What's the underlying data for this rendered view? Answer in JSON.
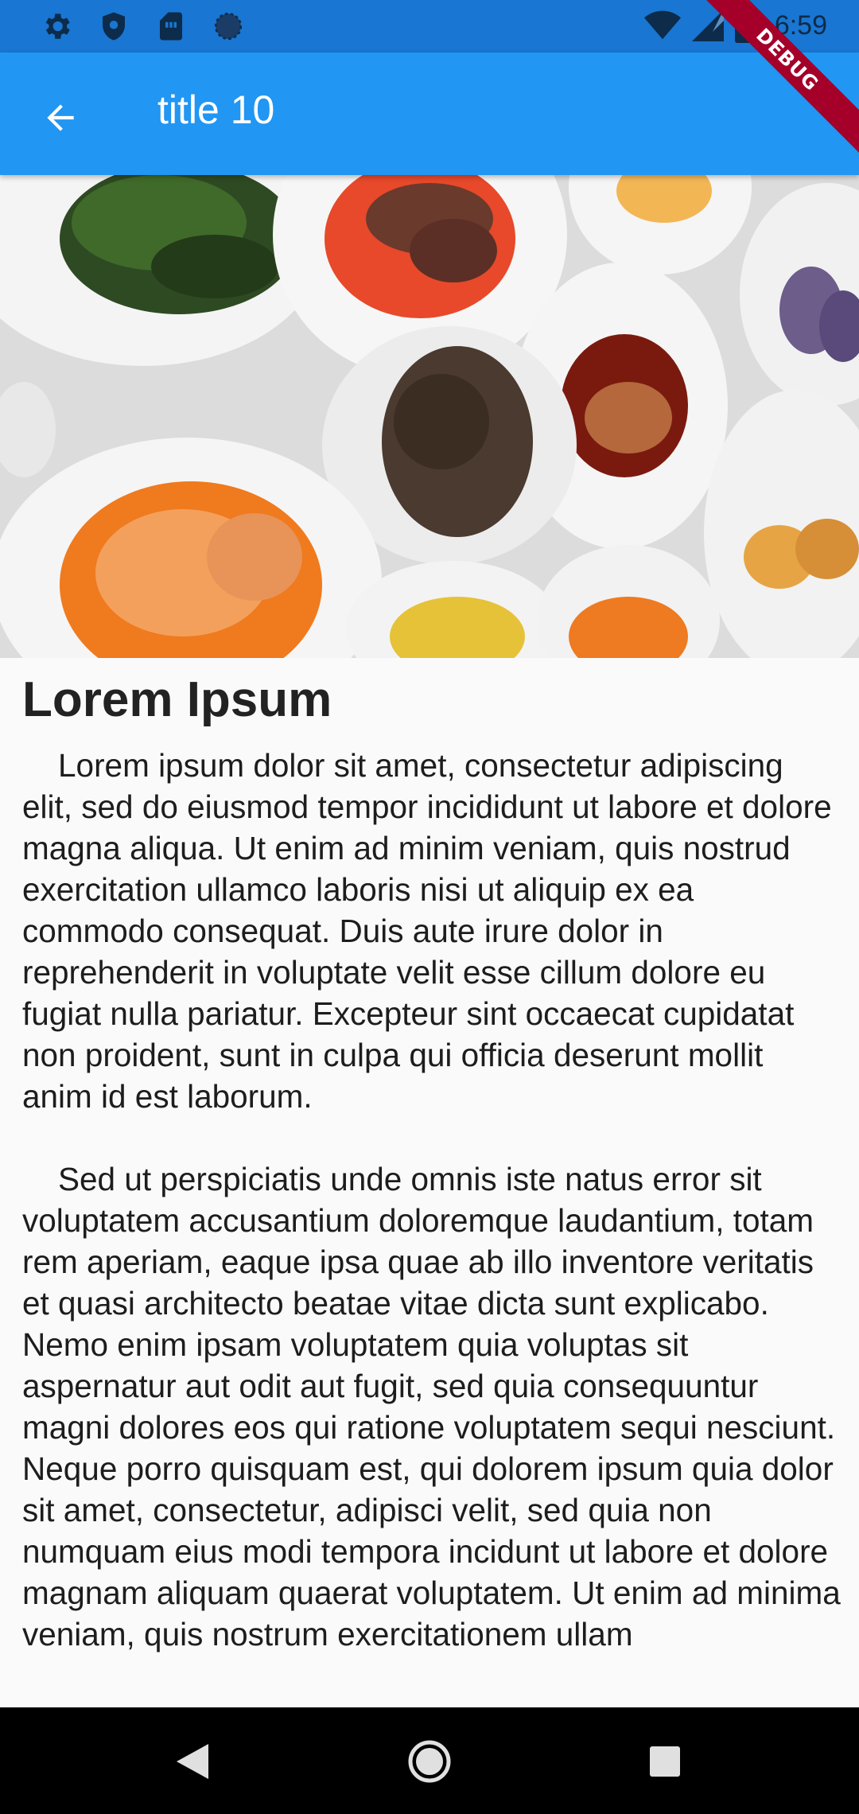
{
  "status_bar": {
    "time": "6:59",
    "icons_left": [
      "settings-icon",
      "shield-icon",
      "sim-card-icon",
      "circle-icon"
    ],
    "icons_right": [
      "wifi-icon",
      "cell-signal-icon",
      "battery-icon"
    ]
  },
  "app_bar": {
    "back_icon": "arrow-back-icon",
    "title": "title 10",
    "color": "#2196f3"
  },
  "debug_banner": "DEBUG",
  "hero_image": {
    "description_icon": "food-plates-image"
  },
  "article": {
    "title": "Lorem Ipsum",
    "paragraph_1": "    Lorem ipsum dolor sit amet, consectetur adipiscing elit, sed do eiusmod tempor incididunt ut labore et dolore magna aliqua. Ut enim ad minim veniam, quis nostrud exercitation ullamco laboris nisi ut aliquip ex ea commodo consequat. Duis aute irure dolor in reprehenderit in voluptate velit esse cillum dolore eu fugiat nulla pariatur. Excepteur sint occaecat cupidatat non proident, sunt in culpa qui officia deserunt mollit anim id est laborum.",
    "paragraph_2": "    Sed ut perspiciatis unde omnis iste natus error sit voluptatem accusantium doloremque laudantium, totam rem aperiam, eaque ipsa quae ab illo inventore veritatis et quasi architecto beatae vitae dicta sunt explicabo. Nemo enim ipsam voluptatem quia voluptas sit aspernatur aut odit aut fugit, sed quia consequuntur magni dolores eos qui ratione voluptatem sequi nesciunt. Neque porro quisquam est, qui dolorem ipsum quia dolor sit amet, consectetur, adipisci velit, sed quia non numquam eius modi tempora incidunt ut labore et dolore magnam aliquam quaerat voluptatem. Ut enim ad minima veniam, quis nostrum exercitationem ullam"
  },
  "nav_bar": {
    "back": "nav-back-icon",
    "home": "nav-home-icon",
    "recents": "nav-recents-icon"
  }
}
